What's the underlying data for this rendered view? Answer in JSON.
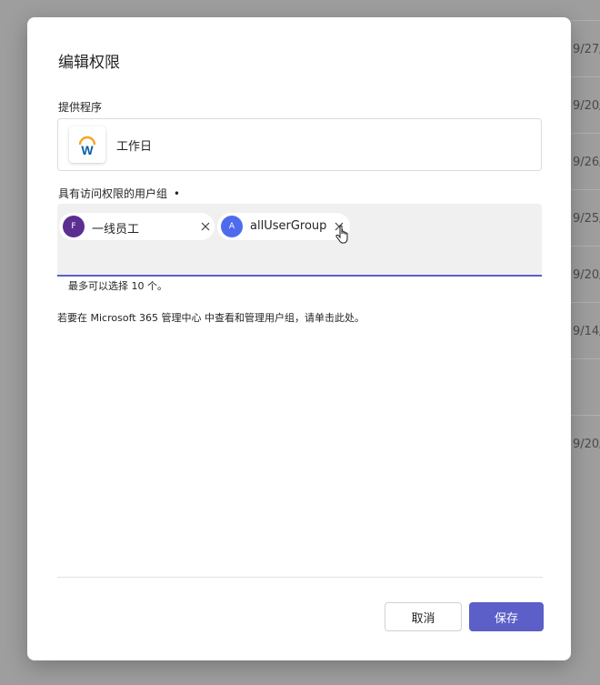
{
  "background": {
    "dates": [
      "9/27/",
      "9/20/",
      "9/26/",
      "9/25/",
      "9/20/",
      "9/14/",
      "",
      "9/20/"
    ]
  },
  "dialog": {
    "title": "编辑权限",
    "provider_label": "提供程序",
    "provider": {
      "name": "工作日",
      "logo_letter": "W",
      "logo_icon": "workday-logo-icon"
    },
    "groups_label": "具有访问权限的用户组",
    "required_marker": "•",
    "groups": [
      {
        "avatar": "F",
        "name": "一线员工",
        "avatar_color": "#5c2e91"
      },
      {
        "avatar": "A",
        "name": "allUserGroup",
        "avatar_color": "#4f6bed"
      }
    ],
    "hint": "最多可以选择 10 个。",
    "info_text": "若要在 Microsoft 365 管理中心 中查看和管理用户组，请单击此处。",
    "cancel_label": "取消",
    "save_label": "保存"
  },
  "colors": {
    "accent": "#5b5fc7",
    "workday_orange": "#f5a623",
    "workday_blue": "#0a5ea8"
  }
}
